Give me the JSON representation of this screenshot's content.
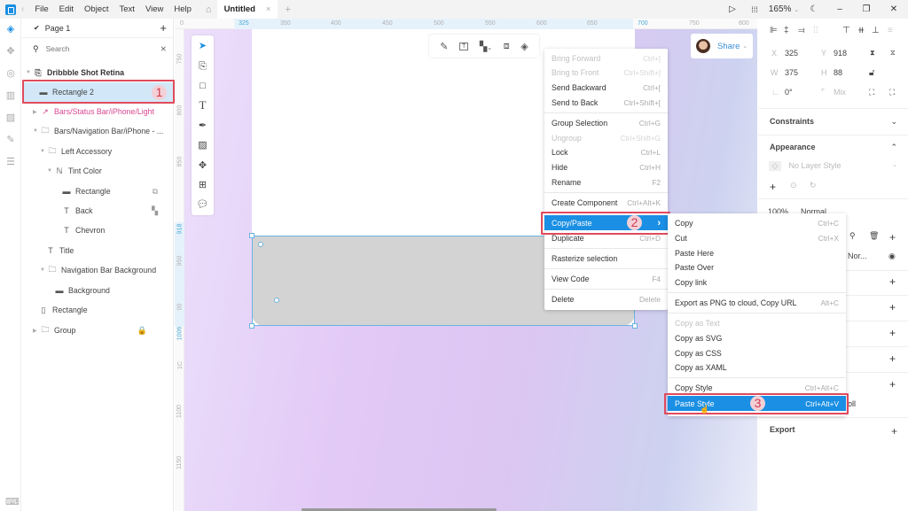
{
  "titlebar": {
    "menus": [
      "File",
      "Edit",
      "Object",
      "Text",
      "View",
      "Help"
    ],
    "tab_title": "Untitled",
    "zoom": "165%"
  },
  "layers_panel": {
    "page": "Page 1",
    "search_placeholder": "Search",
    "items": [
      {
        "label": "Dribbble Shot Retina",
        "icon": "artboard-icon",
        "indent": 0,
        "expanded": true
      },
      {
        "label": "Rectangle 2",
        "icon": "rectangle-icon",
        "indent": 1,
        "selected": true
      },
      {
        "label": "Bars/Status Bar/iPhone/Light",
        "icon": "symbol-instance-icon",
        "indent": 1,
        "color": "#d9468f"
      },
      {
        "label": "Bars/Navigation Bar/iPhone - ...",
        "icon": "folder-icon",
        "indent": 1,
        "expanded": true
      },
      {
        "label": "Left Accessory",
        "icon": "folder-icon",
        "indent": 2,
        "expanded": true
      },
      {
        "label": "Tint Color",
        "icon": "path-icon",
        "indent": 3,
        "expanded": true
      },
      {
        "label": "Rectangle",
        "icon": "rectangle-icon",
        "indent": 4,
        "tail": "mask-icon"
      },
      {
        "label": "Back",
        "icon": "text-icon",
        "indent": 4,
        "tail": "style-icon"
      },
      {
        "label": "Chevron",
        "icon": "text-icon",
        "indent": 4
      },
      {
        "label": "Title",
        "icon": "text-icon",
        "indent": 2
      },
      {
        "label": "Navigation Bar Background",
        "icon": "folder-icon",
        "indent": 2,
        "expanded": true
      },
      {
        "label": "Background",
        "icon": "rectangle-icon",
        "indent": 3
      },
      {
        "label": "Rectangle",
        "icon": "rectangle-vertical-icon",
        "indent": 1
      },
      {
        "label": "Group",
        "icon": "folder-icon",
        "indent": 1,
        "collapsed": true,
        "tail": "lock-icon"
      }
    ]
  },
  "annotations": [
    "1",
    "2",
    "3"
  ],
  "rulers": {
    "horizontal": [
      "0",
      "325",
      "350",
      "400",
      "450",
      "500",
      "550",
      "600",
      "650",
      "700",
      "750",
      "800"
    ],
    "vertical": [
      "750",
      "800",
      "850",
      "918",
      "950",
      "00",
      "1006",
      "1C",
      "1100",
      "1150"
    ]
  },
  "share": {
    "label": "Share"
  },
  "inspector": {
    "x_label": "X",
    "x": "325",
    "y_label": "Y",
    "y": "918",
    "w_label": "W",
    "w": "375",
    "h_label": "H",
    "h": "88",
    "rotation": "0°",
    "radius_label": "Mix",
    "constraints": "Constraints",
    "appearance": "Appearance",
    "layer_style": "No Layer Style",
    "opacity": "100%",
    "blend": "Normal",
    "blend_short": "Nor...",
    "partial_text": "oll",
    "export": "Export"
  },
  "context_menu": {
    "items": [
      {
        "label": "Bring Forward",
        "shortcut": "Ctrl+]",
        "disabled": true
      },
      {
        "label": "Bring to Front",
        "shortcut": "Ctrl+Shift+]",
        "disabled": true
      },
      {
        "label": "Send Backward",
        "shortcut": "Ctrl+["
      },
      {
        "label": "Send to Back",
        "shortcut": "Ctrl+Shift+["
      },
      {
        "label": "Group Selection",
        "shortcut": "Ctrl+G"
      },
      {
        "label": "Ungroup",
        "shortcut": "Ctrl+Shift+G",
        "disabled": true
      },
      {
        "label": "Lock",
        "shortcut": "Ctrl+L"
      },
      {
        "label": "Hide",
        "shortcut": "Ctrl+H"
      },
      {
        "label": "Rename",
        "shortcut": "F2"
      },
      {
        "label": "Create Component",
        "shortcut": "Ctrl+Alt+K"
      },
      {
        "label": "Copy/Paste",
        "shortcut": "›",
        "active": true
      },
      {
        "label": "Duplicate",
        "shortcut": "Ctrl+D"
      },
      {
        "label": "Rasterize selection",
        "shortcut": ""
      },
      {
        "label": "View Code",
        "shortcut": "F4"
      },
      {
        "label": "Delete",
        "shortcut": "Delete"
      }
    ]
  },
  "submenu": {
    "items": [
      {
        "label": "Copy",
        "shortcut": "Ctrl+C"
      },
      {
        "label": "Cut",
        "shortcut": "Ctrl+X"
      },
      {
        "label": "Paste Here",
        "shortcut": ""
      },
      {
        "label": "Paste Over",
        "shortcut": ""
      },
      {
        "label": "Copy link",
        "shortcut": ""
      },
      {
        "label": "Export as PNG to cloud, Copy URL",
        "shortcut": "Alt+C"
      },
      {
        "label": "Copy as Text",
        "shortcut": "",
        "disabled": true
      },
      {
        "label": "Copy as SVG",
        "shortcut": ""
      },
      {
        "label": "Copy as CSS",
        "shortcut": ""
      },
      {
        "label": "Copy as XAML",
        "shortcut": ""
      },
      {
        "label": "Copy Style",
        "shortcut": "Ctrl+Alt+C"
      },
      {
        "label": "Paste Style",
        "shortcut": "Ctrl+Alt+V",
        "active": true
      }
    ]
  }
}
